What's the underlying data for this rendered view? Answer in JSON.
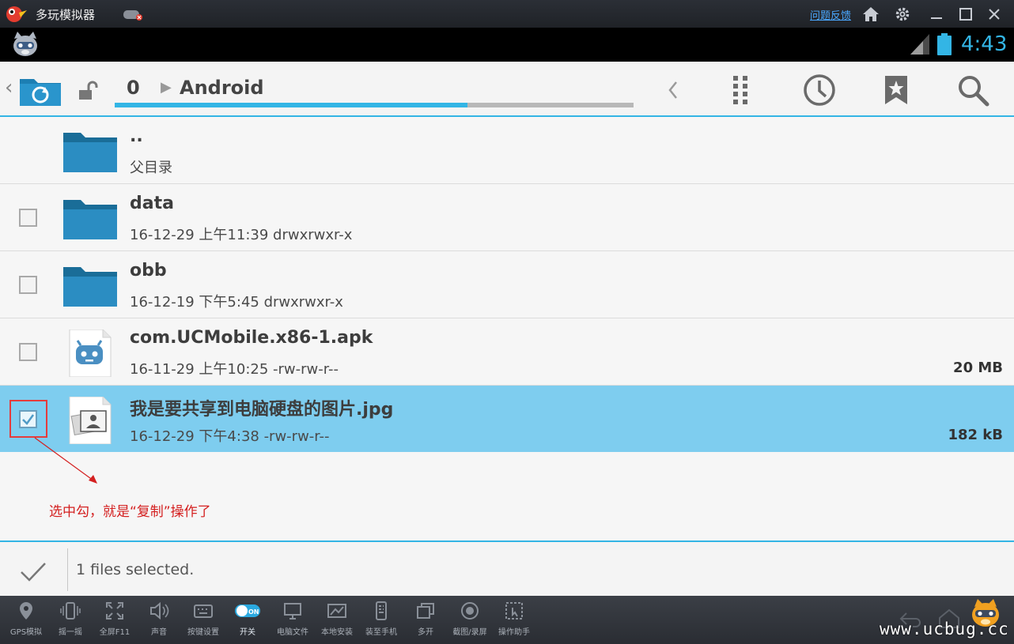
{
  "emulator": {
    "title": "多玩模拟器",
    "feedback_link": "问题反馈",
    "icons": [
      "home-icon",
      "settings-icon",
      "minimize-icon",
      "maximize-icon",
      "close-icon"
    ]
  },
  "statusbar": {
    "time": "4:43"
  },
  "actionbar": {
    "breadcrumbs": [
      "0",
      "Android"
    ],
    "path_progress": 0.68,
    "accent": "#33b5e5"
  },
  "files": [
    {
      "name": "..",
      "meta": "父目录",
      "size": "",
      "type": "folder",
      "checkable": false,
      "checked": false
    },
    {
      "name": "data",
      "meta": "16-12-29 上午11:39   drwxrwxr-x",
      "size": "",
      "type": "folder",
      "checkable": true,
      "checked": false
    },
    {
      "name": "obb",
      "meta": "16-12-19 下午5:45   drwxrwxr-x",
      "size": "",
      "type": "folder",
      "checkable": true,
      "checked": false
    },
    {
      "name": "com.UCMobile.x86-1.apk",
      "meta": "16-11-29 上午10:25   -rw-rw-r--",
      "size": "20 MB",
      "type": "apk",
      "checkable": true,
      "checked": false
    },
    {
      "name": "我是要共享到电脑硬盘的图片.jpg",
      "meta": "16-12-29 下午4:38   -rw-rw-r--",
      "size": "182 kB",
      "type": "image",
      "checkable": true,
      "checked": true
    }
  ],
  "annotation": "选中勾，就是“复制”操作了",
  "selection": {
    "status": "1 files selected."
  },
  "toolbar": {
    "items": [
      {
        "label": "GPS模拟",
        "icon": "location-pin-icon"
      },
      {
        "label": "摇一摇",
        "icon": "shake-icon"
      },
      {
        "label": "全屏F11",
        "icon": "fullscreen-icon"
      },
      {
        "label": "声音",
        "icon": "volume-icon"
      },
      {
        "label": "按键设置",
        "icon": "keyboard-icon"
      },
      {
        "label": "开关",
        "icon": "toggle-on-icon",
        "toggle_text": "ON"
      },
      {
        "label": "电脑文件",
        "icon": "monitor-icon"
      },
      {
        "label": "本地安装",
        "icon": "install-icon"
      },
      {
        "label": "装至手机",
        "icon": "phone-install-icon"
      },
      {
        "label": "多开",
        "icon": "multi-window-icon"
      },
      {
        "label": "截图/录屏",
        "icon": "record-icon"
      },
      {
        "label": "操作助手",
        "icon": "assistant-icon"
      }
    ]
  },
  "watermark": "www.ucbug.cc"
}
